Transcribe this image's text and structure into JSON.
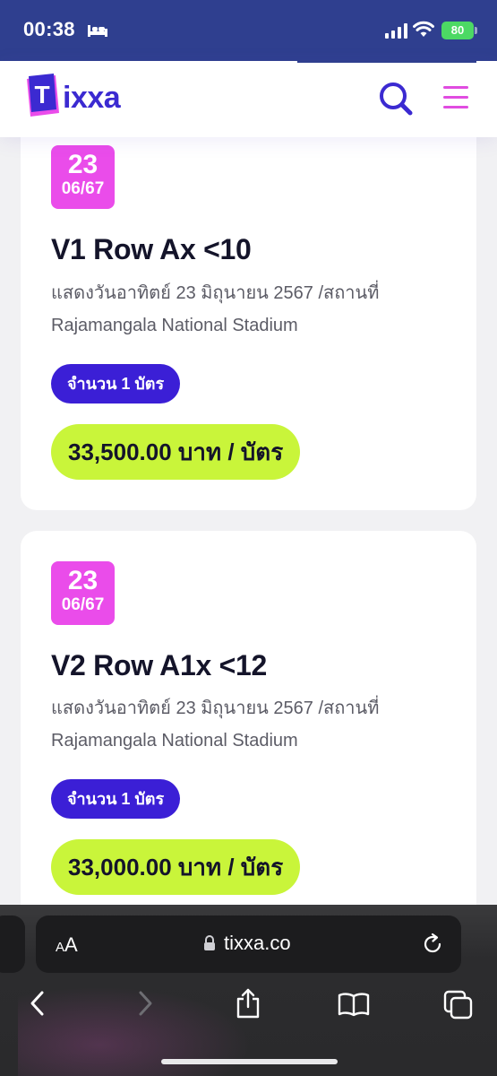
{
  "status_bar": {
    "time": "00:38",
    "battery": "80"
  },
  "header": {
    "logo_initial": "T",
    "logo_text": "ixxa",
    "colors": {
      "brand": "#3b2ad1",
      "accent": "#e04ce0",
      "price": "#c9f53a"
    }
  },
  "listings": [
    {
      "date_day": "23",
      "date_month": "06/67",
      "title": "V1 Row Ax <10",
      "desc_line1": "แสดงวันอาทิตย์ 23 มิถุนายน 2567 /สถานที่",
      "desc_line2": "Rajamangala National Stadium",
      "quantity": "จำนวน 1 บัตร",
      "price": "33,500.00 บาท / บัตร"
    },
    {
      "date_day": "23",
      "date_month": "06/67",
      "title": "V2 Row A1x <12",
      "desc_line1": "แสดงวันอาทิตย์ 23 มิถุนายน 2567 /สถานที่",
      "desc_line2": "Rajamangala National Stadium",
      "quantity": "จำนวน 1 บัตร",
      "price": "33,000.00 บาท / บัตร"
    }
  ],
  "browser": {
    "aa_small": "A",
    "aa_large": "A",
    "url": "tixxa.co"
  }
}
